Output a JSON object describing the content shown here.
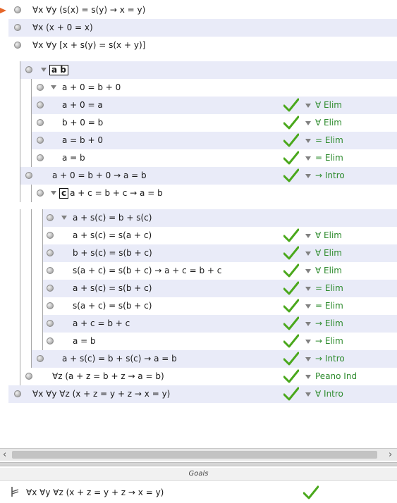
{
  "proof_rows": [
    {
      "formula": "∀x ∀y (s(x) = s(y) → x = y)",
      "depth": 0,
      "band": false,
      "pointer": true
    },
    {
      "formula": "∀x (x + 0 = x)",
      "depth": 0,
      "band": true
    },
    {
      "formula": "∀x ∀y [x + s(y) = s(x + y)]",
      "depth": 0,
      "band": false
    },
    {
      "formula": "",
      "box": "a b",
      "depth": 1,
      "band": true,
      "expander": true
    },
    {
      "formula": "a + 0 = b + 0",
      "depth": 2,
      "band": false,
      "expander": true
    },
    {
      "formula": "a + 0 = a",
      "depth": 2,
      "band": true,
      "rule": "∀ Elim",
      "checked": true
    },
    {
      "formula": "b + 0 = b",
      "depth": 2,
      "band": false,
      "rule": "∀ Elim",
      "checked": true
    },
    {
      "formula": "a = b + 0",
      "depth": 2,
      "band": true,
      "rule": "= Elim",
      "checked": true
    },
    {
      "formula": "a = b",
      "depth": 2,
      "band": false,
      "rule": "= Elim",
      "checked": true
    },
    {
      "formula": "a + 0 = b + 0 → a = b",
      "depth": 1,
      "band": true,
      "rule": "→ Intro",
      "checked": true
    },
    {
      "formula": "a + c = b + c → a = b",
      "box": "c",
      "depth": 2,
      "band": false,
      "expander": true
    },
    {
      "formula": "a + s(c) = b + s(c)",
      "depth": 3,
      "band": true,
      "expander": true
    },
    {
      "formula": "a + s(c) = s(a + c)",
      "depth": 3,
      "band": false,
      "rule": "∀ Elim",
      "checked": true
    },
    {
      "formula": "b + s(c) = s(b + c)",
      "depth": 3,
      "band": true,
      "rule": "∀ Elim",
      "checked": true
    },
    {
      "formula": "s(a + c) = s(b + c) → a + c = b + c",
      "depth": 3,
      "band": false,
      "rule": "∀ Elim",
      "checked": true
    },
    {
      "formula": "a + s(c) = s(b + c)",
      "depth": 3,
      "band": true,
      "rule": "= Elim",
      "checked": true
    },
    {
      "formula": "s(a + c) = s(b + c)",
      "depth": 3,
      "band": false,
      "rule": "= Elim",
      "checked": true
    },
    {
      "formula": "a + c = b + c",
      "depth": 3,
      "band": true,
      "rule": "→ Elim",
      "checked": true
    },
    {
      "formula": "a = b",
      "depth": 3,
      "band": false,
      "rule": "→ Elim",
      "checked": true
    },
    {
      "formula": "a + s(c) = b + s(c) → a = b",
      "depth": 2,
      "band": true,
      "rule": "→ Intro",
      "checked": true
    },
    {
      "formula": "∀z (a + z = b + z → a = b)",
      "depth": 1,
      "band": false,
      "rule": "Peano Ind",
      "checked": true
    },
    {
      "formula": "∀x ∀y ∀z (x + z = y + z → x = y)",
      "depth": 0,
      "band": true,
      "rule": "∀ Intro",
      "checked": true
    }
  ],
  "goals": {
    "title": "Goals",
    "items": [
      {
        "formula": "∀x ∀y ∀z (x + z = y + z → x = y)",
        "checked": true
      }
    ]
  },
  "scrollbar": {
    "left_arrow": "‹",
    "right_arrow": "›"
  },
  "colors": {
    "band": "#e9ebf8",
    "rule_text": "#2e8b2e",
    "check": "#4aa81c",
    "pointer": "#e6672a"
  }
}
